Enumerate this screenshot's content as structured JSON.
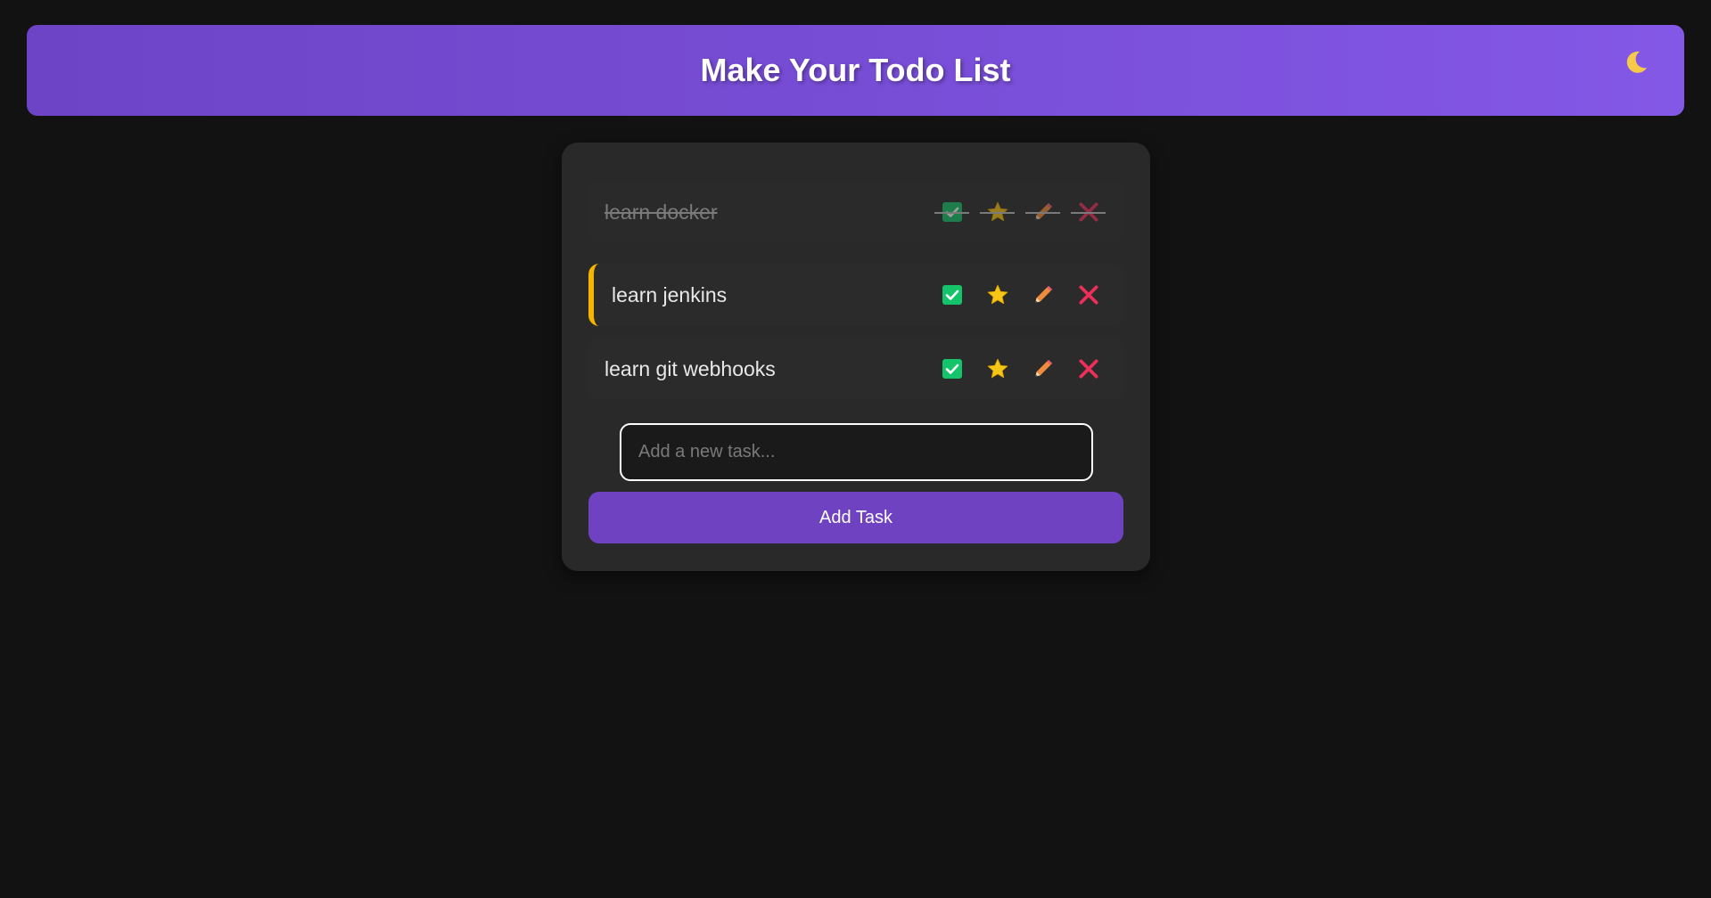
{
  "header": {
    "title": "Make Your Todo List",
    "theme_icon": "moon-icon"
  },
  "tasks": [
    {
      "label": "learn docker",
      "completed": true,
      "priority": false
    },
    {
      "label": "learn jenkins",
      "completed": false,
      "priority": true
    },
    {
      "label": "learn git webhooks",
      "completed": false,
      "priority": false
    }
  ],
  "task_actions": [
    "checkbox-icon",
    "star-icon",
    "pencil-icon",
    "close-icon"
  ],
  "input": {
    "placeholder": "Add a new task...",
    "value": ""
  },
  "add_button": {
    "label": "Add Task"
  },
  "colors": {
    "accent": "#6f42c1",
    "check": "#14c46a",
    "star": "#f5c518",
    "pencil": "#f08a3c",
    "delete": "#ee2f5a",
    "priority_border": "#f5b400"
  }
}
